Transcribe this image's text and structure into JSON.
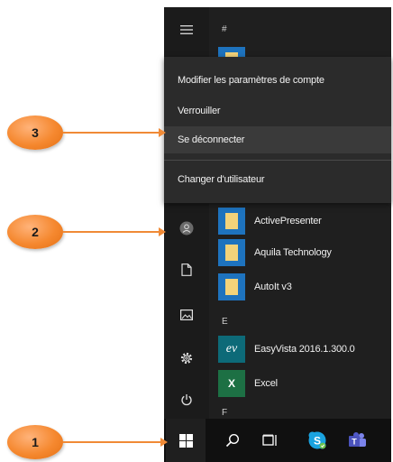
{
  "letters": {
    "top": "#",
    "e": "E",
    "f": "F"
  },
  "popup": {
    "items": [
      "Modifier les paramètres de compte",
      "Verrouiller",
      "Se déconnecter",
      "Changer d'utilisateur"
    ]
  },
  "apps": [
    {
      "label": "ActivePresenter",
      "icon": "folder-icon"
    },
    {
      "label": "Aquila Technology",
      "icon": "folder-icon"
    },
    {
      "label": "AutoIt v3",
      "icon": "folder-icon"
    },
    {
      "label": "EasyVista 2016.1.300.0",
      "icon": "easyvista-icon",
      "tile_text": "ev"
    },
    {
      "label": "Excel",
      "icon": "excel-icon",
      "tile_text": "X"
    }
  ],
  "callouts": {
    "one": "1",
    "two": "2",
    "three": "3"
  },
  "colors": {
    "callout": "#f5882f",
    "tile": "#1e73be",
    "folder": "#f3d37a",
    "excel": "#1d7044"
  }
}
